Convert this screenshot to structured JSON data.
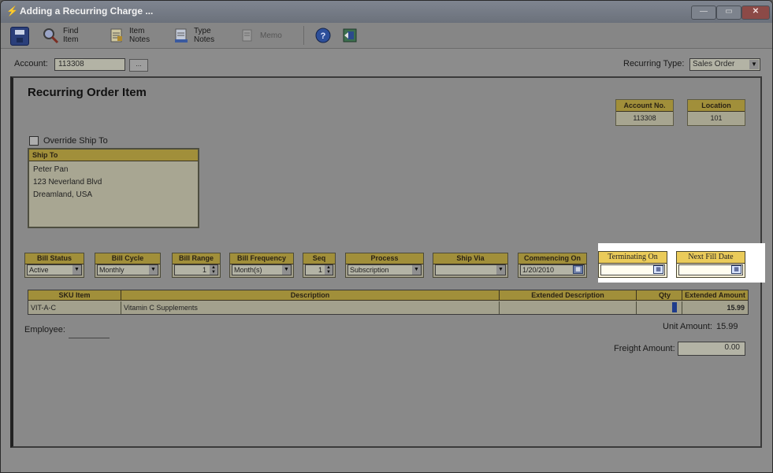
{
  "window": {
    "title": "Adding a Recurring Charge ...",
    "min_glyph": "—",
    "max_glyph": "▭",
    "close_glyph": "✕"
  },
  "toolbar": {
    "save_label": "",
    "find_item": [
      "Find",
      "Item"
    ],
    "item_notes": [
      "Item",
      "Notes"
    ],
    "type_notes": [
      "Type",
      "Notes"
    ],
    "memo": "Memo"
  },
  "account": {
    "label": "Account:",
    "value": "113308",
    "lookup": "..."
  },
  "recurring_type": {
    "label": "Recurring Type:",
    "value": "Sales Order"
  },
  "panel": {
    "title": "Recurring Order Item"
  },
  "account_no": {
    "label": "Account No.",
    "value": "113308"
  },
  "location": {
    "label": "Location",
    "value": "101"
  },
  "override": {
    "label": "Override Ship To"
  },
  "ship_to": {
    "header": "Ship To",
    "lines": [
      "Peter Pan",
      "123 Neverland Blvd",
      "Dreamland, USA"
    ]
  },
  "fields": {
    "bill_status": {
      "label": "Bill Status",
      "value": "Active"
    },
    "bill_cycle": {
      "label": "Bill Cycle",
      "value": "Monthly"
    },
    "bill_range": {
      "label": "Bill Range",
      "value": "1"
    },
    "bill_frequency": {
      "label": "Bill Frequency",
      "value": "Month(s)"
    },
    "seq": {
      "label": "Seq",
      "value": "1"
    },
    "process": {
      "label": "Process",
      "value": "Subscription"
    },
    "ship_via": {
      "label": "Ship Via",
      "value": ""
    },
    "commencing_on": {
      "label": "Commencing On",
      "value": "1/20/2010"
    },
    "terminating_on": {
      "label": "Terminating On",
      "value": ""
    },
    "next_fill_date": {
      "label": "Next Fill Date",
      "value": ""
    }
  },
  "grid": {
    "headers": [
      "SKU Item",
      "Description",
      "Extended Description",
      "Qty",
      "Extended Amount"
    ],
    "row": [
      "VIT-A-C",
      "Vitamin C Supplements",
      "",
      "",
      "15.99"
    ]
  },
  "employee": {
    "label": "Employee:"
  },
  "unit_amount": {
    "label": "Unit Amount:",
    "value": "15.99"
  },
  "freight_amount": {
    "label": "Freight Amount:",
    "value": "0.00"
  }
}
